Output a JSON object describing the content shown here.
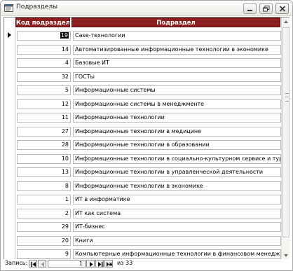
{
  "window": {
    "title": "Подразделы"
  },
  "table": {
    "columns": [
      {
        "label": "Код подраздела"
      },
      {
        "label": "Подраздел"
      }
    ],
    "rows": [
      {
        "code": "19",
        "name": "Case-технологии"
      },
      {
        "code": "14",
        "name": "Автоматизированные информационные технологии в экономике"
      },
      {
        "code": "4",
        "name": "Базовые ИТ"
      },
      {
        "code": "32",
        "name": "ГОСТы"
      },
      {
        "code": "5",
        "name": "Информационные системы"
      },
      {
        "code": "12",
        "name": "Информационные системы в менеджменте"
      },
      {
        "code": "11",
        "name": "Информационные технологии"
      },
      {
        "code": "27",
        "name": "Информационные технологии в медицине"
      },
      {
        "code": "28",
        "name": "Информационные технологии в образовании"
      },
      {
        "code": "10",
        "name": "Информационные технологии в социально-культурном сервисе и туризме"
      },
      {
        "code": "13",
        "name": "Информационные технологии в управленческой деятельности"
      },
      {
        "code": "8",
        "name": "Информационные технологии в экономике"
      },
      {
        "code": "1",
        "name": "ИТ в информатике"
      },
      {
        "code": "2",
        "name": "ИТ как система"
      },
      {
        "code": "29",
        "name": "ИТ-бизнес"
      },
      {
        "code": "20",
        "name": "Книги"
      },
      {
        "code": "9",
        "name": "Компьютерные информационные технологии в финансовом менеджменте"
      }
    ]
  },
  "navigation": {
    "label": "Запись:",
    "current": "1",
    "of_label": "из",
    "total": "33"
  },
  "colors": {
    "header_bg": "#8b1e1e",
    "header_text": "#ffffff"
  }
}
